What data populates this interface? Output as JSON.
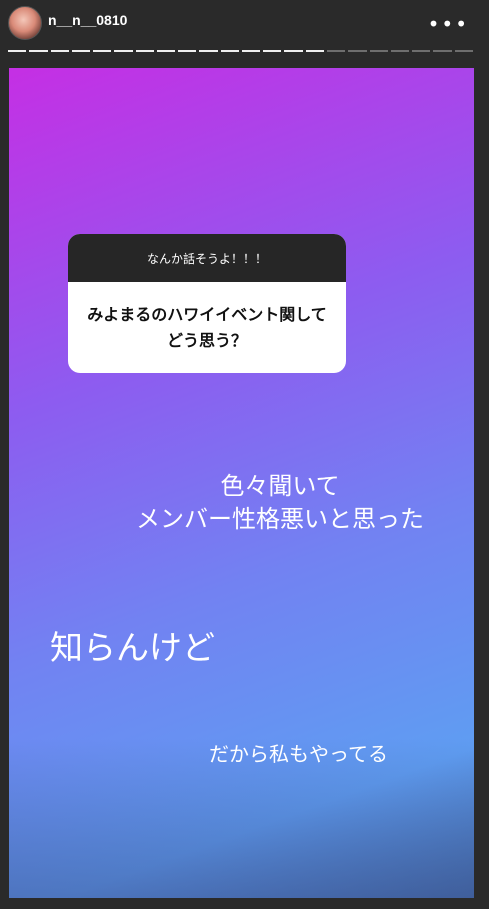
{
  "header": {
    "username": "n__n__0810",
    "more_label": "•••"
  },
  "progress": {
    "total_segments": 22,
    "viewed_segments": 15
  },
  "story": {
    "question_box": {
      "prompt": "なんか話そうよ！！！",
      "question": "みよまるのハワイイベント関してどう思う？"
    },
    "text1": "色々聞いて\nメンバー性格悪いと思った",
    "text2": "知らんけど",
    "text3": "だから私もやってる"
  }
}
